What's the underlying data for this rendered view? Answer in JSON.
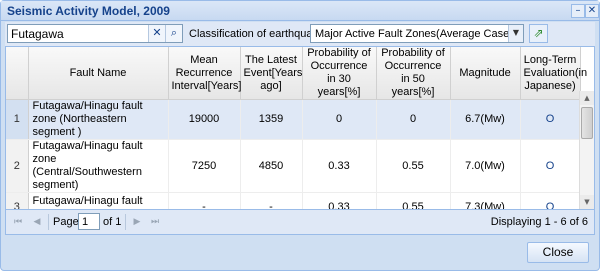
{
  "window": {
    "title": "Seismic Activity Model, 2009",
    "min_icon": "–",
    "close_icon": "✕"
  },
  "toolbar": {
    "search_value": "Futagawa",
    "clear_icon": "✕",
    "search_icon": "⌕",
    "classification_label": "Classification of earthquakes",
    "classification_value": "Major Active Fault Zones(Average Case)",
    "dropdown_icon": "▼",
    "export_icon": "⇗"
  },
  "grid": {
    "columns": [
      "",
      "Fault Name",
      "Mean Recurrence Interval[Years]",
      "The Latest Event[Years ago]",
      "Probability of Occurrence in 30 years[%]",
      "Probability of Occurrence in 50 years[%]",
      "Magnitude",
      "Long-Term Evaluation(in Japanese)"
    ],
    "rows": [
      {
        "num": "1",
        "fault": "Futagawa/Hinagu fault zone (Northeastern segment )",
        "interval": "19000",
        "latest": "1359",
        "p30": "0",
        "p50": "0",
        "magnitude": "6.7(Mw)",
        "eval": "O"
      },
      {
        "num": "2",
        "fault": "Futagawa/Hinagu fault zone (Central/Southwestern segment)",
        "interval": "7250",
        "latest": "4850",
        "p30": "0.33",
        "p50": "0.55",
        "magnitude": "7.0(Mw)",
        "eval": "O"
      },
      {
        "num": "3",
        "fault": "Futagawa/Hinagu fault zone (Central segment)",
        "interval": "-",
        "latest": "-",
        "p30": "0.33",
        "p50": "0.55",
        "magnitude": "7.3(Mw)",
        "eval": "O"
      }
    ]
  },
  "pager": {
    "first_icon": "⏮",
    "prev_icon": "◀",
    "next_icon": "▶",
    "last_icon": "⏭",
    "page_label": "Page",
    "page_value": "1",
    "of_label": "of 1",
    "displaying": "Displaying 1 - 6 of 6"
  },
  "footer": {
    "close_label": "Close"
  }
}
